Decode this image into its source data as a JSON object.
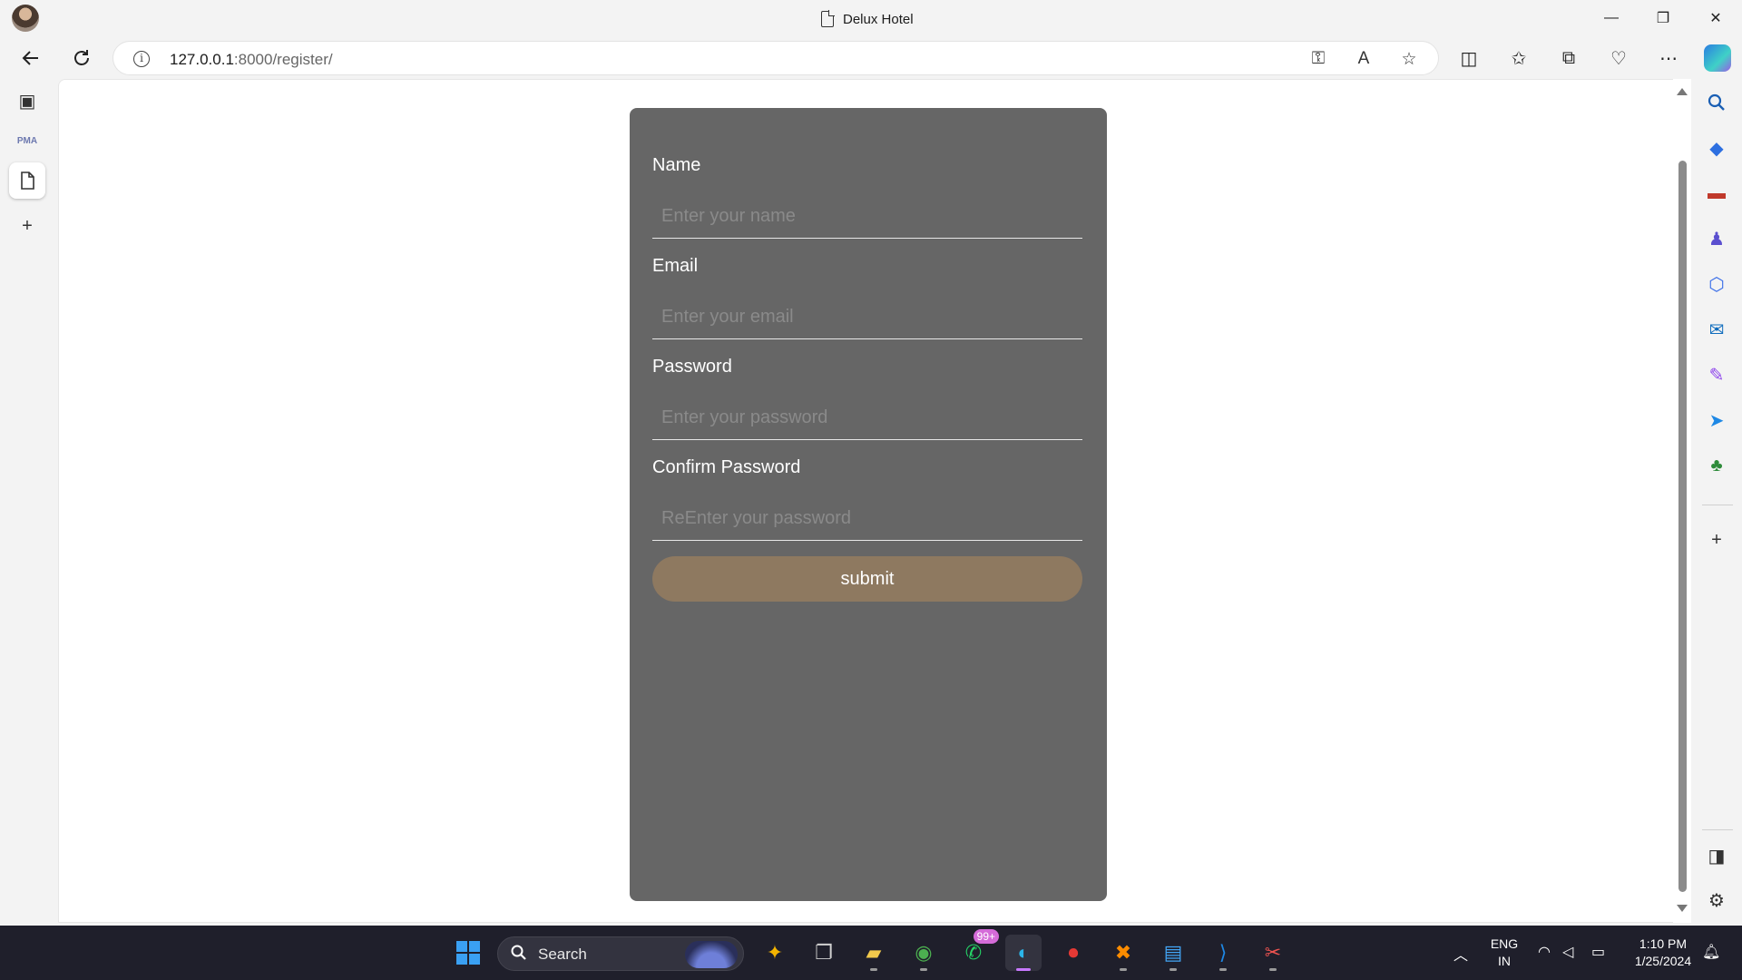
{
  "window": {
    "title": "Delux Hotel",
    "minimize": "—",
    "maximize": "❐",
    "close": "✕"
  },
  "navigation": {
    "url_host": "127.0.0.1",
    "url_path": ":8000/register/"
  },
  "left_strip": {
    "pma_label": "PMA"
  },
  "form": {
    "name_label": "Name",
    "name_placeholder": "Enter your name",
    "email_label": "Email",
    "email_placeholder": "Enter your email",
    "password_label": "Password",
    "password_placeholder": "Enter your password",
    "confirm_label": "Confirm Password",
    "confirm_placeholder": "ReEnter your password",
    "submit_label": "submit"
  },
  "colors": {
    "card_background": "#666666",
    "submit_background": "#8e7960",
    "taskbar_background": "#1f1f2b"
  },
  "taskbar": {
    "search_label": "Search",
    "whatsapp_badge": "99+",
    "language": "ENG",
    "region": "IN",
    "time": "1:10 PM",
    "date": "1/25/2024",
    "apps": [
      "start-icon",
      "search",
      "copilot-pre-icon",
      "task-view-icon",
      "file-explorer-icon",
      "chrome-icon",
      "whatsapp-icon",
      "edge-icon",
      "recorder-icon",
      "xampp-icon",
      "notepad-icon",
      "vscode-icon",
      "snipping-tool-icon"
    ]
  }
}
